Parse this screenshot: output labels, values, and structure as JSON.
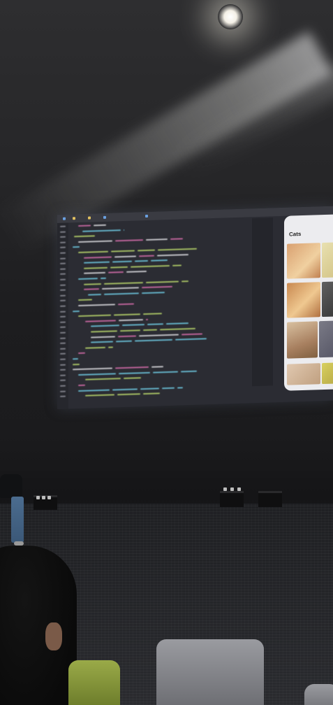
{
  "screen": {
    "phone_title": "Cats"
  },
  "colors": {
    "screen_bg": "#2b2c33",
    "code_keyword": "#d26ba8",
    "code_type": "#6cc6dd",
    "code_function": "#b6d36a",
    "code_plain": "#d8d8dc",
    "seat_green": "#8a9a3c",
    "seat_gray": "#8c8d92"
  },
  "icons": {
    "ceiling_light": "ceiling-light-icon"
  }
}
